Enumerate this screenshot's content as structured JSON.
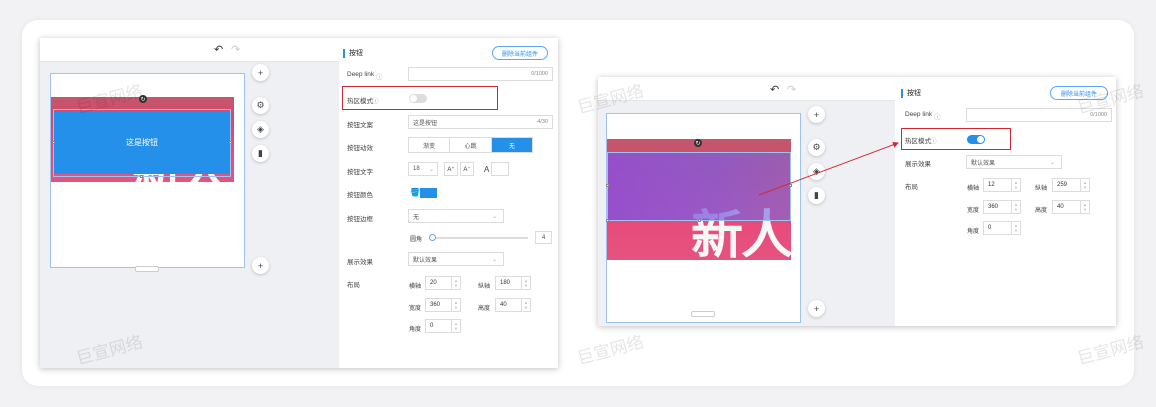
{
  "left": {
    "panel_title": "按钮",
    "delete_label": "删除当前组件",
    "deep_link_label": "Deep link",
    "deep_link_count": "0/1000",
    "hotzone_label": "热区模式",
    "button_copy_label": "按钮文案",
    "button_copy_value": "这是按钮",
    "button_copy_count": "4/30",
    "anim_label": "按钮动效",
    "anim_options": [
      "渐变",
      "心跳",
      "无"
    ],
    "text_label": "按钮文字",
    "font_size": "18",
    "font_inc": "A⁺",
    "font_dec": "A⁻",
    "font_color_glyph": "A",
    "color_label": "按钮颜色",
    "border_label": "按钮边框",
    "border_value": "无",
    "radius_label": "圆角",
    "radius_value": "4",
    "display_label": "展示效果",
    "display_value": "默认效果",
    "layout_label": "布局",
    "x_label": "横轴",
    "x_value": "20",
    "y_label": "纵轴",
    "y_value": "180",
    "w_label": "宽度",
    "w_value": "360",
    "h_label": "高度",
    "h_value": "40",
    "angle_label": "角度",
    "angle_value": "0",
    "canvas_button_text": "这是按钮",
    "banner_text": "新人"
  },
  "right": {
    "panel_title": "按钮",
    "delete_label": "删除当前组件",
    "deep_link_label": "Deep link",
    "deep_link_count": "0/1000",
    "hotzone_label": "热区模式",
    "display_label": "展示效果",
    "display_value": "默认效果",
    "layout_label": "布局",
    "x_label": "横轴",
    "x_value": "12",
    "y_label": "纵轴",
    "y_value": "259",
    "w_label": "宽度",
    "w_value": "360",
    "h_label": "高度",
    "h_value": "40",
    "angle_label": "角度",
    "angle_value": "0",
    "banner_text": "新人"
  },
  "watermark": "巨宣网络",
  "colors": {
    "accent": "#2590ea",
    "highlight": "#d2272f"
  }
}
